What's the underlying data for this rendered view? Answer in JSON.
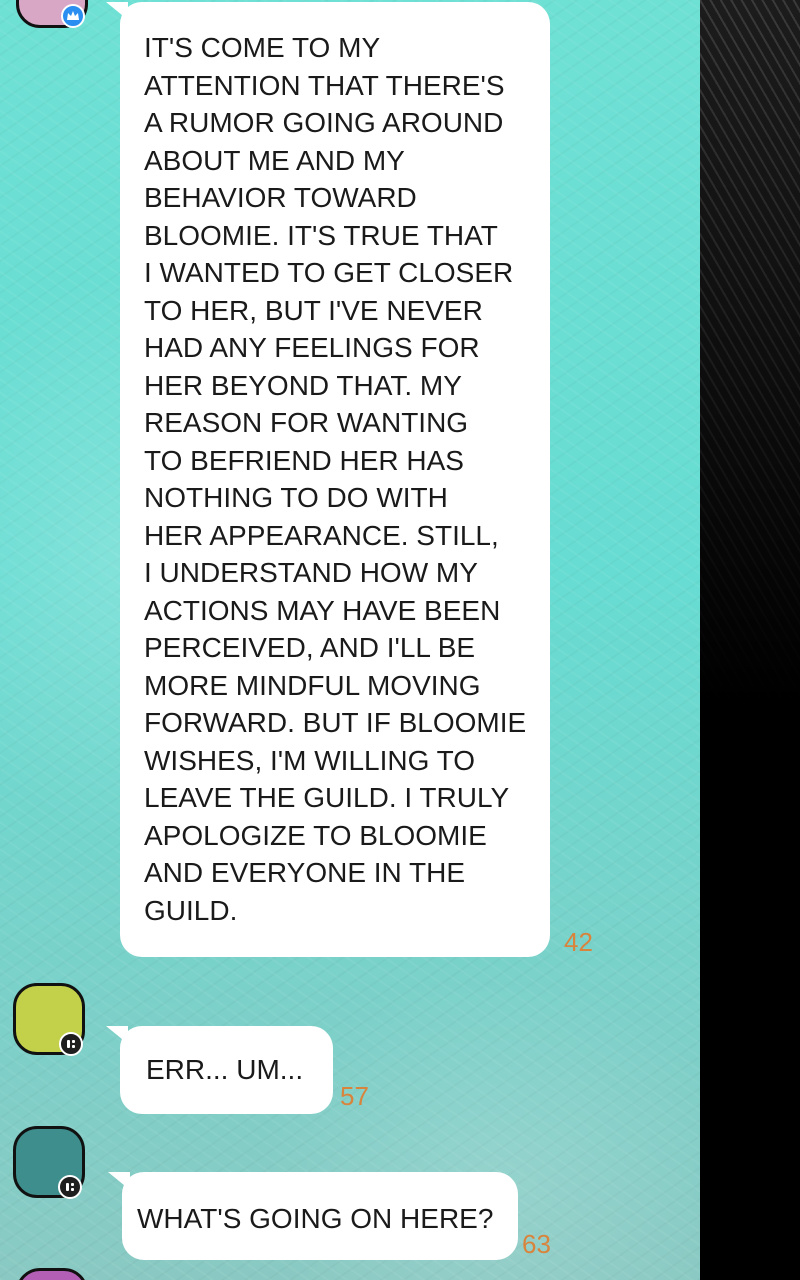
{
  "messages": [
    {
      "text": "IT'S COME TO MY\nATTENTION THAT THERE'S\nA RUMOR GOING AROUND\nABOUT ME AND MY\nBEHAVIOR TOWARD\nBLOOMIE. IT'S TRUE THAT\nI WANTED TO GET CLOSER\nTO HER, BUT I'VE NEVER\nHAD ANY FEELINGS FOR\nHER BEYOND THAT. MY\nREASON FOR WANTING\nTO BEFRIEND HER HAS\nNOTHING TO DO WITH\nHER APPEARANCE. STILL,\nI UNDERSTAND HOW MY\nACTIONS MAY HAVE BEEN\nPERCEIVED, AND I'LL BE\nMORE MINDFUL MOVING\nFORWARD. BUT IF BLOOMIE\nWISHES, I'M WILLING TO\nLEAVE THE GUILD. I TRULY\nAPOLOGIZE TO BLOOMIE\nAND EVERYONE IN THE\nGUILD.",
      "read_count": "42",
      "avatar_color": "#d9a7c6",
      "badge_icon": "crown-icon"
    },
    {
      "text": "ERR... UM...",
      "read_count": "57",
      "avatar_color": "#c3d14a",
      "badge_icon": "member-icon"
    },
    {
      "text": "WHAT'S GOING ON HERE?",
      "read_count": "63",
      "avatar_color": "#3d8e8c",
      "badge_icon": "member-icon"
    }
  ],
  "colors": {
    "chat_background": "#6fe0d4",
    "bubble": "#ffffff",
    "read_count": "#d9843c",
    "side_panel": "#000000",
    "badge_blue": "#2a8ff0",
    "next_avatar": "#b35fb6"
  }
}
